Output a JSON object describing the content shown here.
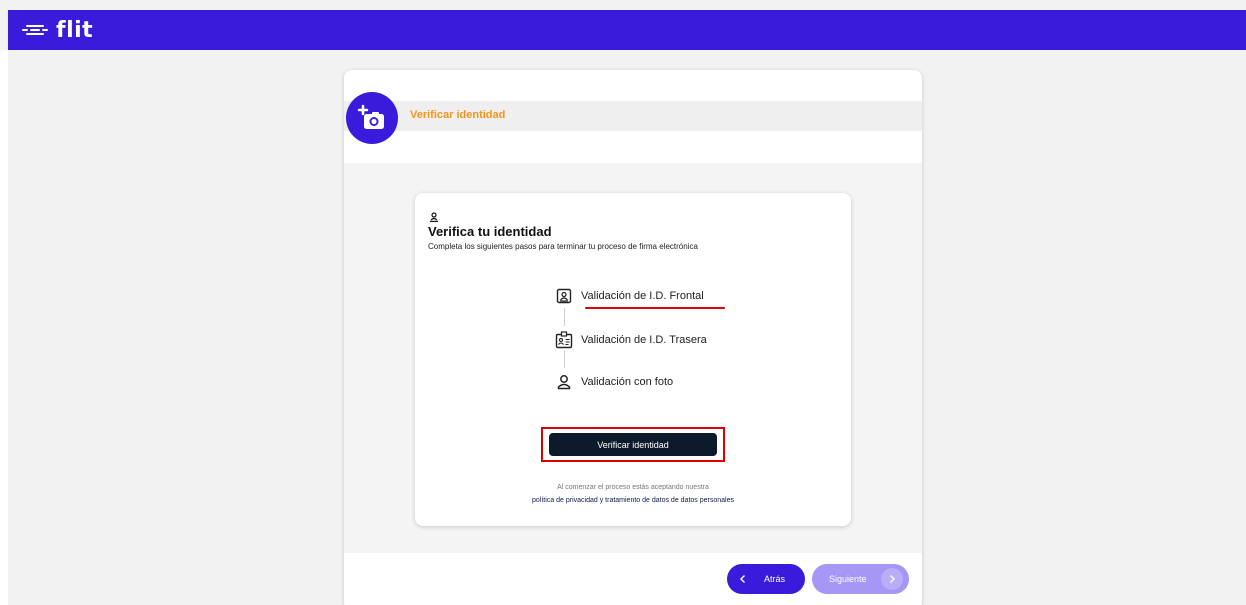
{
  "app": {
    "logo_text": "flit"
  },
  "wizard": {
    "step_title": "Verificar identidad"
  },
  "verify": {
    "title": "Verifica tu identidad",
    "subtitle": "Completa los siguientes pasos para terminar tu proceso de firma electrónica",
    "steps": [
      {
        "label": "Validación de I.D. Frontal",
        "icon": "id-card-front-icon"
      },
      {
        "label": "Validación de I.D. Trasera",
        "icon": "id-card-back-icon"
      },
      {
        "label": "Validación con foto",
        "icon": "user-icon"
      }
    ],
    "button_label": "Verificar identidad",
    "terms_line1": "Al comenzar el proceso estás aceptando nuestra",
    "terms_link": "política de privacidad y tratamiento de datos de datos personales"
  },
  "nav": {
    "back_label": "Atrás",
    "next_label": "Siguiente"
  },
  "colors": {
    "brand": "#3a1bdc",
    "accent": "#f7941d",
    "button_dark": "#0c1a2b",
    "highlight": "#e00000"
  }
}
